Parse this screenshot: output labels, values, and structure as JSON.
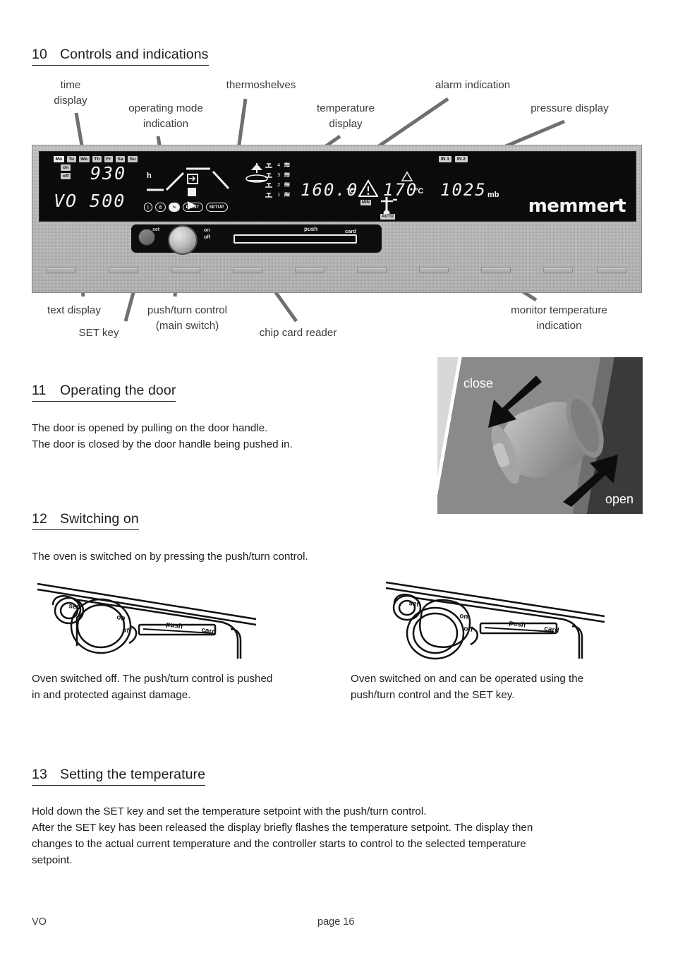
{
  "sections": {
    "s10": {
      "num": "10",
      "title": "Controls and indications"
    },
    "s11": {
      "num": "11",
      "title": "Operating the door",
      "body": "The door is opened by pulling on the door handle.\nThe door is closed by the door handle being pushed in."
    },
    "s12": {
      "num": "12",
      "title": "Switching on",
      "body": "The oven is switched on by pressing the push/turn control.",
      "caption_left": "Oven switched off. The push/turn control is pushed\nin and protected against damage.",
      "caption_right": "Oven switched on and can be operated using the\npush/turn control and the SET key."
    },
    "s13": {
      "num": "13",
      "title": "Setting the temperature",
      "body": "Hold down the SET key and set the temperature setpoint with the push/turn control.\nAfter the SET key has been released the display briefly flashes the temperature setpoint. The display then\nchanges to the actual current temperature and the controller starts to control to the selected temperature\nsetpoint."
    }
  },
  "callouts": {
    "time_display": "time\ndisplay",
    "operating_mode": "operating mode\nindication",
    "thermoshelves": "thermoshelves",
    "temperature_display": "temperature\ndisplay",
    "alarm_indication": "alarm indication",
    "pressure_display": "pressure display",
    "text_display": "text display",
    "set_key": "SET key",
    "push_turn_control": "push/turn control\n(main switch)",
    "chip_card_reader": "chip card reader",
    "monitor_temperature": "monitor temperature\nindication"
  },
  "panel": {
    "days": [
      "Mo",
      "Tu",
      "We",
      "Th",
      "Fr",
      "Sa",
      "Su"
    ],
    "active_day": "Mo",
    "on_label": "on",
    "off_label": "off",
    "time_value": "930",
    "time_unit": "h",
    "text_value": "VO  500",
    "mode_buttons": [
      {
        "label": "|",
        "selected": false
      },
      {
        "label": "◴",
        "selected": false
      },
      {
        "label": "∿",
        "selected": true
      },
      {
        "label": "PRINT",
        "selected": false
      },
      {
        "label": "SETUP",
        "selected": false
      }
    ],
    "shelves": [
      {
        "number": "4"
      },
      {
        "number": "3"
      },
      {
        "number": "2"
      },
      {
        "number": "1"
      }
    ],
    "temperature_value": "160.0",
    "temperature_unit": "°C",
    "monitor_value": "170",
    "monitor_unit": "°C",
    "monitor_min_tag": "MIN",
    "monitor_auto_tag": "AUTO",
    "inputs": [
      "IN 1",
      "IN 2"
    ],
    "pressure_value": "1025",
    "pressure_unit": "mb",
    "brand": "memmer",
    "brand_tail": "t",
    "set_label": "set",
    "knob_on_label": "on",
    "knob_off_label": "off",
    "push_label": "push",
    "card_label": "card"
  },
  "door_image": {
    "close_label": "close",
    "open_label": "open"
  },
  "drawings": {
    "set_label": "set",
    "on_label": "on",
    "off_label": "off",
    "push_label": "push",
    "card_label": "card"
  },
  "footer": {
    "left": "VO",
    "center": "page 16"
  },
  "colors": {
    "text": "#1d1d1b",
    "leader": "#6f6f6e",
    "panel_dark": "#0b0b0b",
    "panel_gray": "#bdbdbd"
  }
}
